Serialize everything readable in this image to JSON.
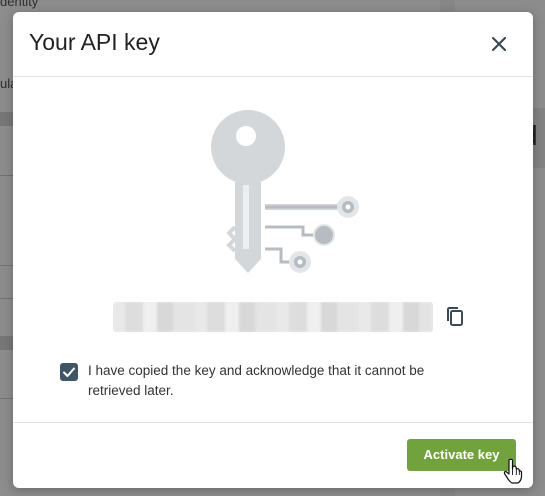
{
  "background": {
    "left_text_top": "dentity",
    "left_text_mid": "ula",
    "right_text": "d"
  },
  "modal": {
    "title": "Your API key",
    "close_icon": "close-icon",
    "illustration_icon": "key-circuit-icon",
    "api_key": {
      "value": "••••••••••••••••••••••••••••••••",
      "masked": true
    },
    "copy_icon": "copy-icon",
    "acknowledge": {
      "checked": true,
      "label": "I have copied the key and acknowledge that it cannot be retrieved later."
    },
    "activate_button": "Activate key"
  },
  "colors": {
    "accent_green": "#72a23d",
    "checkbox": "#3f5566",
    "icon_gray": "#c7cbcf"
  }
}
